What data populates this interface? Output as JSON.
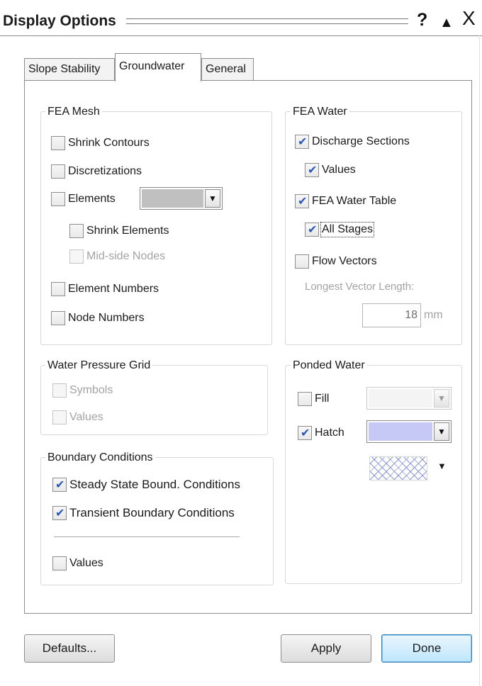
{
  "window": {
    "title": "Display Options",
    "help": "?",
    "collapse": "▲",
    "close": "X"
  },
  "tabs": [
    {
      "label": "Slope Stability"
    },
    {
      "label": "Groundwater",
      "selected": true
    },
    {
      "label": "General"
    }
  ],
  "fea_mesh": {
    "title": "FEA Mesh",
    "items": {
      "shrink_contours": {
        "label": "Shrink Contours",
        "checked": false
      },
      "discretizations": {
        "label": "Discretizations",
        "checked": false
      },
      "elements": {
        "label": "Elements",
        "checked": false,
        "color": "#c0c0c0"
      },
      "shrink_elements": {
        "label": "Shrink Elements",
        "checked": false
      },
      "mid_side_nodes": {
        "label": "Mid-side Nodes",
        "checked": false,
        "disabled": true
      },
      "element_numbers": {
        "label": "Element Numbers",
        "checked": false
      },
      "node_numbers": {
        "label": "Node Numbers",
        "checked": false
      }
    }
  },
  "fea_water": {
    "title": "FEA Water",
    "items": {
      "discharge_sections": {
        "label": "Discharge Sections",
        "checked": true
      },
      "discharge_values": {
        "label": "Values",
        "checked": true
      },
      "fea_water_table": {
        "label": "FEA Water Table",
        "checked": true
      },
      "all_stages": {
        "label": "All Stages",
        "checked": true
      },
      "flow_vectors": {
        "label": "Flow Vectors",
        "checked": false
      }
    },
    "longest_vector_label": "Longest Vector Length:",
    "longest_vector_value": "18",
    "longest_vector_unit": "mm"
  },
  "water_pressure_grid": {
    "title": "Water Pressure Grid",
    "items": {
      "symbols": {
        "label": "Symbols",
        "checked": false,
        "disabled": true
      },
      "values": {
        "label": "Values",
        "checked": false,
        "disabled": true
      }
    }
  },
  "ponded_water": {
    "title": "Ponded Water",
    "items": {
      "fill": {
        "label": "Fill",
        "checked": false
      },
      "hatch": {
        "label": "Hatch",
        "checked": true,
        "color": "#c6c8f6"
      }
    }
  },
  "boundary_conditions": {
    "title": "Boundary Conditions",
    "items": {
      "steady_state": {
        "label": "Steady State Bound. Conditions",
        "checked": true
      },
      "transient": {
        "label": "Transient Boundary Conditions",
        "checked": true
      },
      "values": {
        "label": "Values",
        "checked": false
      }
    }
  },
  "buttons": {
    "defaults": "Defaults...",
    "apply": "Apply",
    "done": "Done"
  },
  "colors": {
    "check_mark": "#2a57b8",
    "done_button": "#bee6fd",
    "disabled_text": "#a3a3a3"
  },
  "icons": {
    "help": "question-mark-icon",
    "collapse": "triangle-up-icon",
    "close": "close-icon",
    "dropdown": "chevron-down-icon"
  }
}
